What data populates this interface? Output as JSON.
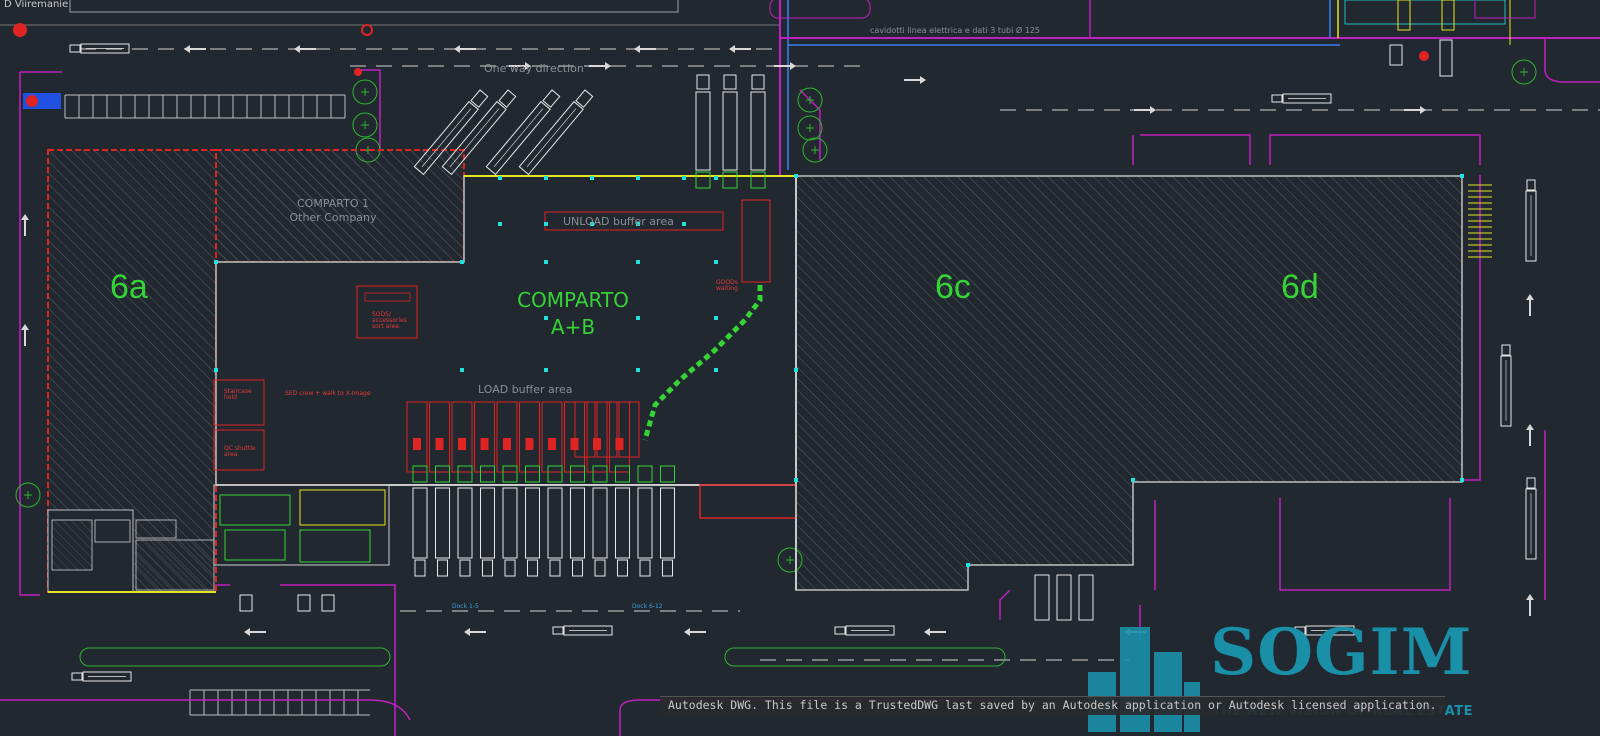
{
  "viewer": {
    "file_tab": "D Viiremanie",
    "status_note": "Autodesk DWG.  This file is a TrustedDWG last saved by an Autodesk application or Autodesk licensed application."
  },
  "drawing": {
    "zones": {
      "zone_6a": "6a",
      "zone_6c": "6c",
      "zone_6d": "6d",
      "comparto_ab_line1": "COMPARTO",
      "comparto_ab_line2": "A+B",
      "comparto_1_line1": "COMPARTO 1",
      "comparto_1_line2": "Other Company"
    },
    "labels": {
      "one_way": "One way direction",
      "unload_buffer": "UNLOAD buffer area",
      "load_buffer": "LOAD buffer area",
      "cable_note": "cavidotti linea elettrica e dati 3 tubi Ø 125",
      "small_red_box": "SODS/ accessories sort area",
      "exit_note": "SED crew + walk to X-Image",
      "goods_label": "GOODs waiting",
      "staircase_hold": "Staircase hold",
      "shuttle_area": "QC shuttle area",
      "dock_label_1": "Dock 1-5",
      "dock_label_2": "Dock 6-12"
    },
    "colors": {
      "background": "#212830",
      "building_outline_red": "#e02424",
      "zone_text_green": "#35d335",
      "magenta_lines": "#c020c0",
      "yellow_lines": "#e6e620",
      "cyan_markers": "#20e0e0",
      "hatch_grey": "#5a5e64"
    }
  },
  "watermark": {
    "brand": "SOGIM",
    "tagline": "THE NEW VISION OF REAL ESTATE",
    "color": "#1a8fa8",
    "icon": "building-logo-icon"
  }
}
